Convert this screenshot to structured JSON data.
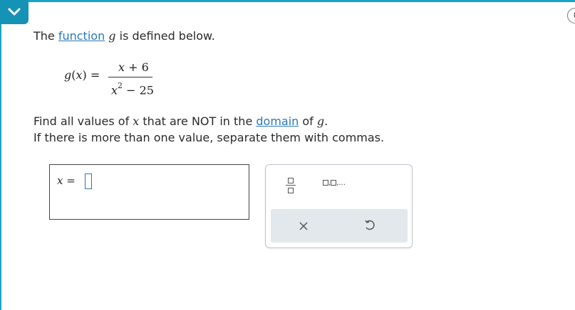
{
  "help_button": "(",
  "prompt": {
    "prefix": "The ",
    "link": "function",
    "var": "g",
    "suffix": " is defined below."
  },
  "equation": {
    "lhs_func": "g",
    "lhs_arg": "x",
    "equals": "=",
    "numerator_var": "x",
    "numerator_rest": " + 6",
    "denominator_var": "x",
    "denominator_exp": "2",
    "denominator_rest": " − 25"
  },
  "instructions": {
    "line1_a": "Find all values of ",
    "line1_var": "x",
    "line1_b": " that are NOT in the ",
    "line1_link": "domain",
    "line1_c": " of ",
    "line1_fn": "g",
    "line1_d": ".",
    "line2": "If there is more than one value, separate them with commas."
  },
  "answer": {
    "var": "x",
    "equals": "=",
    "value": ""
  },
  "keypad": {
    "list_ellipsis": ",..."
  }
}
